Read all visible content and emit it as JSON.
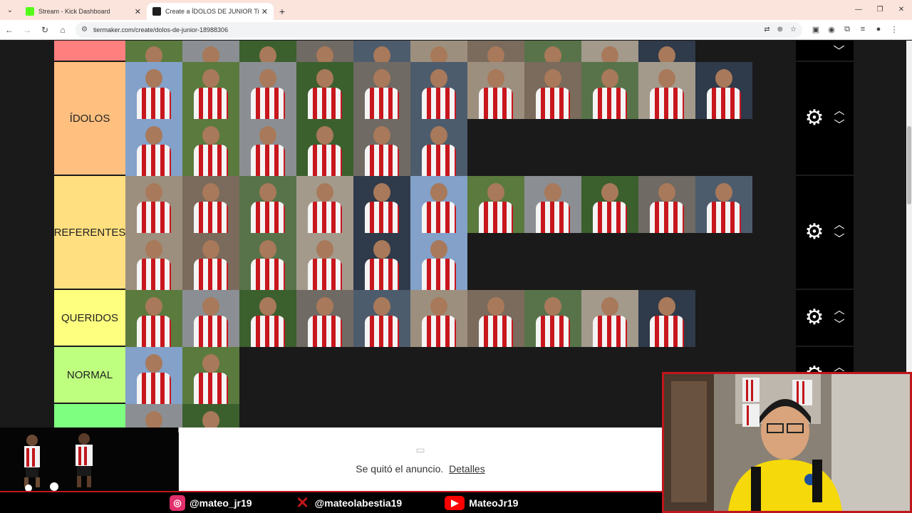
{
  "browser": {
    "tabs": [
      {
        "title": "Stream - Kick Dashboard",
        "active": false,
        "favicon_color": "#53fc18"
      },
      {
        "title": "Create a ÍDOLOS DE JUNIOR Tier",
        "active": true,
        "favicon_color": "#1f1f1f"
      }
    ],
    "url": "tiermaker.com/create/dolos-de-junior-18988306"
  },
  "tiers": [
    {
      "label": "",
      "color": "#ff7f7f",
      "tiles": 10
    },
    {
      "label": "ÍDOLOS",
      "color": "#ffbf7f",
      "tiles": 17
    },
    {
      "label": "REFERENTES",
      "color": "#ffdf7f",
      "tiles": 17
    },
    {
      "label": "QUERIDOS",
      "color": "#ffff7f",
      "tiles": 10
    },
    {
      "label": "NORMAL",
      "color": "#bfff7f",
      "tiles": 2
    },
    {
      "label": "",
      "color": "#7fff7f",
      "tiles": 2
    }
  ],
  "ad": {
    "text": "Se quitó el anuncio.",
    "link": "Detalles"
  },
  "socials": [
    {
      "icon": "instagram-icon",
      "handle": "@mateo_jr19",
      "color": "#e1306c"
    },
    {
      "icon": "x-icon",
      "handle": "@mateolabestia19",
      "color": "#c0161b"
    },
    {
      "icon": "youtube-icon",
      "handle": "MateoJr19",
      "color": "#ff0000"
    }
  ]
}
